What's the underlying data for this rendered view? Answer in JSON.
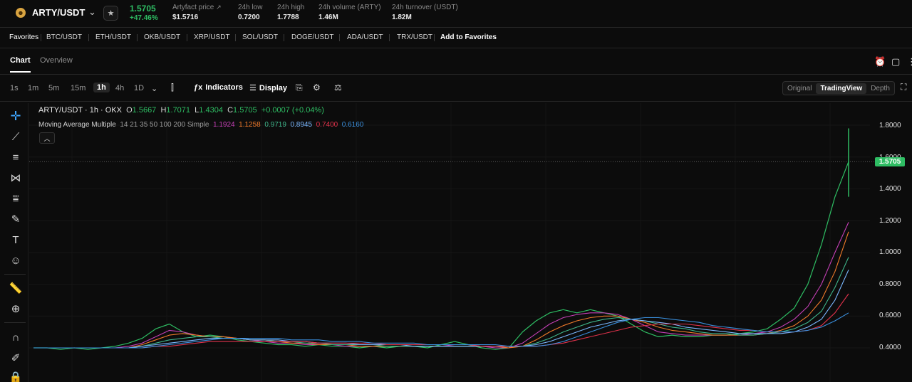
{
  "ticker": {
    "pair": "ARTY/USDT",
    "last_price": "1.5705",
    "change": "+47.46%",
    "stats": [
      {
        "label": "Artyfact price",
        "value": "$1.5716"
      },
      {
        "label": "24h low",
        "value": "0.7200"
      },
      {
        "label": "24h high",
        "value": "1.7788"
      },
      {
        "label": "24h volume (ARTY)",
        "value": "1.46M"
      },
      {
        "label": "24h turnover (USDT)",
        "value": "1.82M"
      }
    ]
  },
  "favorites": {
    "label": "Favorites",
    "items": [
      "BTC/USDT",
      "ETH/USDT",
      "OKB/USDT",
      "XRP/USDT",
      "SOL/USDT",
      "DOGE/USDT",
      "ADA/USDT",
      "TRX/USDT"
    ],
    "add_label": "Add to Favorites"
  },
  "tabs": [
    "Chart",
    "Overview"
  ],
  "toolbar": {
    "intervals": [
      "1s",
      "1m",
      "5m",
      "15m",
      "1h",
      "4h",
      "1D"
    ],
    "active_interval": "1h",
    "indicators_label": "Indicators",
    "display_label": "Display",
    "views": [
      "Original",
      "TradingView",
      "Depth"
    ],
    "active_view": "TradingView"
  },
  "legend": {
    "title": "ARTY/USDT · 1h · OKX",
    "o_label": "O",
    "o_value": "1.5667",
    "h_label": "H",
    "h_value": "1.7071",
    "l_label": "L",
    "l_value": "1.4304",
    "c_label": "C",
    "c_value": "1.5705",
    "change_value": "+0.0007 (+0.04%)",
    "ma_title": "Moving Average Multiple",
    "ma_params": "14 21 35 50 100 200 Simple",
    "ma_values": [
      {
        "value": "1.1924",
        "color": "#c43fb5"
      },
      {
        "value": "1.1258",
        "color": "#f07a2a"
      },
      {
        "value": "0.9719",
        "color": "#3fb68b"
      },
      {
        "value": "0.8945",
        "color": "#7bb8ff"
      },
      {
        "value": "0.7400",
        "color": "#e0324b"
      },
      {
        "value": "0.6160",
        "color": "#3a8fdd"
      }
    ]
  },
  "price_axis": {
    "labels": [
      "1.8000",
      "1.6000",
      "1.4000",
      "1.2000",
      "1.0000",
      "0.8000",
      "0.6000",
      "0.4000"
    ],
    "current_price_tag": "1.5705"
  },
  "chart_data": {
    "type": "line",
    "ylim": [
      0.3,
      1.9
    ],
    "current_price": 1.5705,
    "series": [
      {
        "values": [
          0.4,
          0.4,
          0.39,
          0.4,
          0.39,
          0.4,
          0.41,
          0.43,
          0.46,
          0.52,
          0.55,
          0.5,
          0.47,
          0.48,
          0.47,
          0.45,
          0.44,
          0.43,
          0.42,
          0.42,
          0.41,
          0.42,
          0.41,
          0.41,
          0.4,
          0.41,
          0.4,
          0.41,
          0.41,
          0.4,
          0.42,
          0.44,
          0.42,
          0.4,
          0.39,
          0.4,
          0.5,
          0.57,
          0.62,
          0.64,
          0.62,
          0.64,
          0.62,
          0.6,
          0.55,
          0.5,
          0.47,
          0.48,
          0.47,
          0.47,
          0.48,
          0.48,
          0.49,
          0.5,
          0.52,
          0.58,
          0.65,
          0.8,
          1.05,
          1.35,
          1.57
        ],
        "color": "#2ebd63"
      },
      {
        "values": [
          0.4,
          0.4,
          0.4,
          0.4,
          0.4,
          0.4,
          0.4,
          0.41,
          0.43,
          0.47,
          0.51,
          0.5,
          0.48,
          0.47,
          0.47,
          0.46,
          0.45,
          0.44,
          0.43,
          0.43,
          0.42,
          0.42,
          0.42,
          0.41,
          0.41,
          0.41,
          0.41,
          0.41,
          0.41,
          0.41,
          0.41,
          0.42,
          0.42,
          0.41,
          0.4,
          0.4,
          0.43,
          0.49,
          0.55,
          0.59,
          0.61,
          0.62,
          0.62,
          0.61,
          0.58,
          0.54,
          0.5,
          0.49,
          0.48,
          0.48,
          0.48,
          0.48,
          0.48,
          0.49,
          0.5,
          0.53,
          0.58,
          0.66,
          0.8,
          1.0,
          1.19
        ],
        "color": "#c43fb5"
      },
      {
        "values": [
          0.4,
          0.4,
          0.4,
          0.4,
          0.4,
          0.4,
          0.4,
          0.4,
          0.42,
          0.45,
          0.48,
          0.49,
          0.48,
          0.47,
          0.47,
          0.46,
          0.45,
          0.45,
          0.44,
          0.43,
          0.43,
          0.42,
          0.42,
          0.42,
          0.41,
          0.41,
          0.41,
          0.41,
          0.41,
          0.41,
          0.41,
          0.41,
          0.41,
          0.41,
          0.41,
          0.4,
          0.41,
          0.45,
          0.5,
          0.54,
          0.57,
          0.59,
          0.6,
          0.6,
          0.58,
          0.56,
          0.53,
          0.51,
          0.5,
          0.49,
          0.48,
          0.48,
          0.48,
          0.48,
          0.49,
          0.51,
          0.54,
          0.6,
          0.7,
          0.88,
          1.13
        ],
        "color": "#f07a2a"
      },
      {
        "values": [
          0.4,
          0.4,
          0.4,
          0.4,
          0.4,
          0.4,
          0.4,
          0.4,
          0.41,
          0.43,
          0.45,
          0.46,
          0.47,
          0.47,
          0.46,
          0.46,
          0.45,
          0.45,
          0.44,
          0.44,
          0.43,
          0.43,
          0.42,
          0.42,
          0.42,
          0.42,
          0.41,
          0.41,
          0.41,
          0.41,
          0.41,
          0.41,
          0.41,
          0.41,
          0.41,
          0.41,
          0.41,
          0.43,
          0.46,
          0.5,
          0.53,
          0.56,
          0.58,
          0.59,
          0.58,
          0.57,
          0.55,
          0.53,
          0.52,
          0.5,
          0.49,
          0.49,
          0.48,
          0.48,
          0.49,
          0.5,
          0.52,
          0.56,
          0.63,
          0.78,
          0.97
        ],
        "color": "#3fb68b"
      },
      {
        "values": [
          0.4,
          0.4,
          0.4,
          0.4,
          0.4,
          0.4,
          0.4,
          0.4,
          0.41,
          0.42,
          0.43,
          0.44,
          0.45,
          0.46,
          0.46,
          0.46,
          0.45,
          0.45,
          0.45,
          0.44,
          0.44,
          0.43,
          0.43,
          0.43,
          0.42,
          0.42,
          0.42,
          0.42,
          0.41,
          0.41,
          0.41,
          0.41,
          0.41,
          0.41,
          0.41,
          0.41,
          0.41,
          0.42,
          0.44,
          0.47,
          0.5,
          0.53,
          0.55,
          0.57,
          0.58,
          0.57,
          0.56,
          0.55,
          0.53,
          0.52,
          0.51,
          0.5,
          0.49,
          0.49,
          0.49,
          0.49,
          0.5,
          0.53,
          0.58,
          0.7,
          0.89
        ],
        "color": "#7bb8ff"
      },
      {
        "values": [
          0.4,
          0.4,
          0.4,
          0.4,
          0.4,
          0.4,
          0.4,
          0.4,
          0.4,
          0.41,
          0.41,
          0.42,
          0.43,
          0.44,
          0.44,
          0.44,
          0.44,
          0.44,
          0.44,
          0.44,
          0.44,
          0.43,
          0.43,
          0.43,
          0.43,
          0.43,
          0.42,
          0.42,
          0.42,
          0.42,
          0.42,
          0.42,
          0.42,
          0.41,
          0.41,
          0.41,
          0.41,
          0.41,
          0.42,
          0.43,
          0.45,
          0.47,
          0.49,
          0.51,
          0.53,
          0.54,
          0.55,
          0.55,
          0.55,
          0.54,
          0.53,
          0.52,
          0.51,
          0.51,
          0.5,
          0.5,
          0.5,
          0.51,
          0.54,
          0.62,
          0.74
        ],
        "color": "#e0324b"
      },
      {
        "values": [
          0.4,
          0.4,
          0.4,
          0.4,
          0.4,
          0.4,
          0.4,
          0.4,
          0.4,
          0.41,
          0.42,
          0.43,
          0.44,
          0.45,
          0.46,
          0.46,
          0.46,
          0.46,
          0.46,
          0.45,
          0.45,
          0.45,
          0.44,
          0.44,
          0.44,
          0.43,
          0.43,
          0.43,
          0.43,
          0.42,
          0.42,
          0.42,
          0.42,
          0.42,
          0.42,
          0.41,
          0.41,
          0.41,
          0.42,
          0.44,
          0.47,
          0.5,
          0.53,
          0.56,
          0.58,
          0.59,
          0.59,
          0.58,
          0.57,
          0.56,
          0.54,
          0.53,
          0.52,
          0.51,
          0.5,
          0.5,
          0.5,
          0.51,
          0.53,
          0.57,
          0.62
        ],
        "color": "#3a8fdd"
      }
    ]
  }
}
